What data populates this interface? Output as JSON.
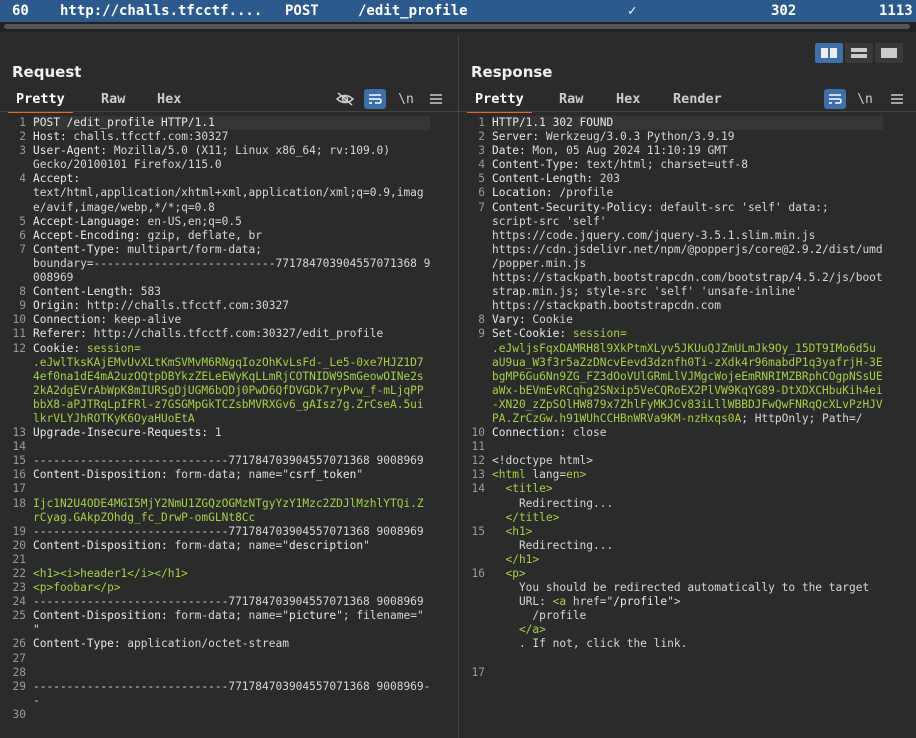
{
  "top_row": {
    "number": "60",
    "host": "http://challs.tfcctf....",
    "method": "POST",
    "path": "/edit_profile",
    "check": "✓",
    "status": "302",
    "length": "1113"
  },
  "request": {
    "title": "Request",
    "tabs": [
      "Pretty",
      "Raw",
      "Hex"
    ],
    "lines": [
      {
        "n": "1",
        "segs": [
          {
            "t": "POST /edit_profile HTTP/1.1",
            "c": "k"
          }
        ]
      },
      {
        "n": "2",
        "segs": [
          {
            "t": "Host: ",
            "c": "k"
          },
          {
            "t": "challs.tfcctf.com:30327",
            "c": "v"
          }
        ]
      },
      {
        "n": "3",
        "segs": [
          {
            "t": "User-Agent: ",
            "c": "k"
          },
          {
            "t": "Mozilla/5.0 (X11; Linux x86_64; rv:109.0)",
            "c": "v"
          }
        ]
      },
      {
        "n": "",
        "segs": [
          {
            "t": "Gecko/20100101 Firefox/115.0",
            "c": "v"
          }
        ]
      },
      {
        "n": "4",
        "segs": [
          {
            "t": "Accept:",
            "c": "k"
          }
        ]
      },
      {
        "n": "",
        "segs": [
          {
            "t": "text/html,application/xhtml+xml,application/xml;q=0.9,imag",
            "c": "v"
          }
        ]
      },
      {
        "n": "",
        "segs": [
          {
            "t": "e/avif,image/webp,*/*;q=0.8",
            "c": "v"
          }
        ]
      },
      {
        "n": "5",
        "segs": [
          {
            "t": "Accept-Language: ",
            "c": "k"
          },
          {
            "t": "en-US,en;q=0.5",
            "c": "v"
          }
        ]
      },
      {
        "n": "6",
        "segs": [
          {
            "t": "Accept-Encoding: ",
            "c": "k"
          },
          {
            "t": "gzip, deflate, br",
            "c": "v"
          }
        ]
      },
      {
        "n": "7",
        "segs": [
          {
            "t": "Content-Type: ",
            "c": "k"
          },
          {
            "t": "multipart/form-data;",
            "c": "v"
          }
        ]
      },
      {
        "n": "",
        "segs": [
          {
            "t": "boundary=---------------------------771784703904557071368 9",
            "c": "v"
          }
        ]
      },
      {
        "n": "",
        "segs": [
          {
            "t": "008969",
            "c": "v"
          }
        ]
      },
      {
        "n": "8",
        "segs": [
          {
            "t": "Content-Length: ",
            "c": "k"
          },
          {
            "t": "583",
            "c": "v"
          }
        ]
      },
      {
        "n": "9",
        "segs": [
          {
            "t": "Origin: ",
            "c": "k"
          },
          {
            "t": "http://challs.tfcctf.com:30327",
            "c": "v"
          }
        ]
      },
      {
        "n": "10",
        "segs": [
          {
            "t": "Connection: ",
            "c": "k"
          },
          {
            "t": "keep-alive",
            "c": "v"
          }
        ]
      },
      {
        "n": "11",
        "segs": [
          {
            "t": "Referer: ",
            "c": "k"
          },
          {
            "t": "http://challs.tfcctf.com:30327/edit_profile",
            "c": "v"
          }
        ]
      },
      {
        "n": "12",
        "segs": [
          {
            "t": "Cookie: ",
            "c": "k"
          },
          {
            "t": "session=",
            "c": "g"
          }
        ]
      },
      {
        "n": "",
        "segs": [
          {
            "t": ".eJwlTksKAjEMvUvXLtKmSVMvM6RNgqIozOhKvLsFd-_Le5-0xe7HJZ1D7",
            "c": "g"
          }
        ]
      },
      {
        "n": "",
        "segs": [
          {
            "t": "4ef0na1dE4mA2uzOQtpDBYkzZELeEWyKqLLmRjCOTNIDW9SmGeowOINe2s",
            "c": "g"
          }
        ]
      },
      {
        "n": "",
        "segs": [
          {
            "t": "2kA2dgEVrAbWpK8mIURSgDjUGM6bQDj0PwD6QfDVGDk7ryPvw_f-mLjqPP",
            "c": "g"
          }
        ]
      },
      {
        "n": "",
        "segs": [
          {
            "t": "bbX8-aPJTRqLpIFRl-z7GSGMpGkTCZsbMVRXGv6_gAIsz7g.ZrCseA.5ui",
            "c": "g"
          }
        ]
      },
      {
        "n": "",
        "segs": [
          {
            "t": "lkrVLYJhROTKyK6OyaHUoEtA",
            "c": "g"
          }
        ]
      },
      {
        "n": "13",
        "segs": [
          {
            "t": "Upgrade-Insecure-Requests: ",
            "c": "k"
          },
          {
            "t": "1",
            "c": "v"
          }
        ]
      },
      {
        "n": "14",
        "segs": [
          {
            "t": "",
            "c": "v"
          }
        ]
      },
      {
        "n": "15",
        "segs": [
          {
            "t": "-----------------------------771784703904557071368 9008969",
            "c": "v"
          }
        ]
      },
      {
        "n": "16",
        "segs": [
          {
            "t": "Content-Disposition: ",
            "c": "k"
          },
          {
            "t": "form-data; name=\"",
            "c": "v"
          },
          {
            "t": "csrf_token",
            "c": "k"
          },
          {
            "t": "\"",
            "c": "v"
          }
        ]
      },
      {
        "n": "17",
        "segs": [
          {
            "t": "",
            "c": "v"
          }
        ]
      },
      {
        "n": "18",
        "segs": [
          {
            "t": "Ijc1N2U4ODE4MGI5MjY2NmU1ZGQzOGMzNTgyYzY1Mzc2ZDJlMzhlYTQi.Z",
            "c": "g"
          }
        ]
      },
      {
        "n": "",
        "segs": [
          {
            "t": "rCyag.GAkpZOhdg_fc_DrwP-omGLNt8Cc",
            "c": "g"
          }
        ]
      },
      {
        "n": "19",
        "segs": [
          {
            "t": "-----------------------------771784703904557071368 9008969",
            "c": "v"
          }
        ]
      },
      {
        "n": "20",
        "segs": [
          {
            "t": "Content-Disposition: ",
            "c": "k"
          },
          {
            "t": "form-data; name=\"",
            "c": "v"
          },
          {
            "t": "description",
            "c": "k"
          },
          {
            "t": "\"",
            "c": "v"
          }
        ]
      },
      {
        "n": "21",
        "segs": [
          {
            "t": "",
            "c": "v"
          }
        ]
      },
      {
        "n": "22",
        "segs": [
          {
            "t": "<h1><i>header1</i></h1>",
            "c": "g"
          }
        ]
      },
      {
        "n": "23",
        "segs": [
          {
            "t": "<p>foobar</p>",
            "c": "g"
          }
        ]
      },
      {
        "n": "24",
        "segs": [
          {
            "t": "-----------------------------771784703904557071368 9008969",
            "c": "v"
          }
        ]
      },
      {
        "n": "25",
        "segs": [
          {
            "t": "Content-Disposition: ",
            "c": "k"
          },
          {
            "t": "form-data; name=\"",
            "c": "v"
          },
          {
            "t": "picture",
            "c": "k"
          },
          {
            "t": "\"; filename=\"",
            "c": "v"
          }
        ]
      },
      {
        "n": "",
        "segs": [
          {
            "t": "\"",
            "c": "v"
          }
        ]
      },
      {
        "n": "26",
        "segs": [
          {
            "t": "Content-Type: ",
            "c": "k"
          },
          {
            "t": "application/octet-stream",
            "c": "v"
          }
        ]
      },
      {
        "n": "27",
        "segs": [
          {
            "t": "",
            "c": "v"
          }
        ]
      },
      {
        "n": "28",
        "segs": [
          {
            "t": "",
            "c": "v"
          }
        ]
      },
      {
        "n": "29",
        "segs": [
          {
            "t": "-----------------------------771784703904557071368 9008969-",
            "c": "v"
          }
        ]
      },
      {
        "n": "",
        "segs": [
          {
            "t": "-",
            "c": "v"
          }
        ]
      },
      {
        "n": "30",
        "segs": [
          {
            "t": "",
            "c": "v"
          }
        ]
      }
    ]
  },
  "response": {
    "title": "Response",
    "tabs": [
      "Pretty",
      "Raw",
      "Hex",
      "Render"
    ],
    "lines": [
      {
        "n": "1",
        "segs": [
          {
            "t": "HTTP/1.1 302 FOUND",
            "c": "k"
          }
        ]
      },
      {
        "n": "2",
        "segs": [
          {
            "t": "Server: ",
            "c": "k"
          },
          {
            "t": "Werkzeug/3.0.3 Python/3.9.19",
            "c": "v"
          }
        ]
      },
      {
        "n": "3",
        "segs": [
          {
            "t": "Date: ",
            "c": "k"
          },
          {
            "t": "Mon, 05 Aug 2024 11:10:19 GMT",
            "c": "v"
          }
        ]
      },
      {
        "n": "4",
        "segs": [
          {
            "t": "Content-Type: ",
            "c": "k"
          },
          {
            "t": "text/html; charset=utf-8",
            "c": "v"
          }
        ]
      },
      {
        "n": "5",
        "segs": [
          {
            "t": "Content-Length: ",
            "c": "k"
          },
          {
            "t": "203",
            "c": "v"
          }
        ]
      },
      {
        "n": "6",
        "segs": [
          {
            "t": "Location: ",
            "c": "k"
          },
          {
            "t": "/profile",
            "c": "v"
          }
        ]
      },
      {
        "n": "7",
        "segs": [
          {
            "t": "Content-Security-Policy: ",
            "c": "k"
          },
          {
            "t": "default-src 'self' data:;",
            "c": "v"
          }
        ]
      },
      {
        "n": "",
        "segs": [
          {
            "t": "script-src 'self'",
            "c": "v"
          }
        ]
      },
      {
        "n": "",
        "segs": [
          {
            "t": "https://code.jquery.com/jquery-3.5.1.slim.min.js",
            "c": "v"
          }
        ]
      },
      {
        "n": "",
        "segs": [
          {
            "t": "https://cdn.jsdelivr.net/npm/@popperjs/core@2.9.2/dist/umd",
            "c": "v"
          }
        ]
      },
      {
        "n": "",
        "segs": [
          {
            "t": "/popper.min.js",
            "c": "v"
          }
        ]
      },
      {
        "n": "",
        "segs": [
          {
            "t": "https://stackpath.bootstrapcdn.com/bootstrap/4.5.2/js/boot",
            "c": "v"
          }
        ]
      },
      {
        "n": "",
        "segs": [
          {
            "t": "strap.min.js; style-src 'self' 'unsafe-inline'",
            "c": "v"
          }
        ]
      },
      {
        "n": "",
        "segs": [
          {
            "t": "https://stackpath.bootstrapcdn.com",
            "c": "v"
          }
        ]
      },
      {
        "n": "8",
        "segs": [
          {
            "t": "Vary: ",
            "c": "k"
          },
          {
            "t": "Cookie",
            "c": "v"
          }
        ]
      },
      {
        "n": "9",
        "segs": [
          {
            "t": "Set-Cookie: ",
            "c": "k"
          },
          {
            "t": "session=",
            "c": "g"
          }
        ]
      },
      {
        "n": "",
        "segs": [
          {
            "t": ".eJwljsFqxDAMRH8l9XkPtmXLyv5JKUuQJZmULmJk9Oy_15DT9IMo6d5u",
            "c": "g"
          }
        ]
      },
      {
        "n": "",
        "segs": [
          {
            "t": "aU9ua_W3f3r5aZzDNcvEevd3dznfh0Ti-zXdk4r96mabdP1q3yafrjH-3E",
            "c": "g"
          }
        ]
      },
      {
        "n": "",
        "segs": [
          {
            "t": "bgMP6Gu6Nn9ZG_FZ3dOoVUlGRmLlVJMgcWojeEmRNRIMZBRphCOgpNSsUE",
            "c": "g"
          }
        ]
      },
      {
        "n": "",
        "segs": [
          {
            "t": "aWx-bEVmEvRCqhg2SNxip5VeCQRoEX2PlVW9KqYG89-DtXDXCHbuKih4ei",
            "c": "g"
          }
        ]
      },
      {
        "n": "",
        "segs": [
          {
            "t": "-XN20_zZpSOlHW879x7ZhlFyMKJCv83iLllWBBDJFwQwFNRqQcXLvPzHJV",
            "c": "g"
          }
        ]
      },
      {
        "n": "",
        "segs": [
          {
            "t": "PA.ZrCzGw.h91WUhCCHBnWRVa9KM-nzHxqs0A",
            "c": "g"
          },
          {
            "t": "; HttpOnly; Path=/",
            "c": "v"
          }
        ]
      },
      {
        "n": "10",
        "segs": [
          {
            "t": "Connection: ",
            "c": "k"
          },
          {
            "t": "close",
            "c": "v"
          }
        ]
      },
      {
        "n": "11",
        "segs": [
          {
            "t": "",
            "c": "v"
          }
        ]
      },
      {
        "n": "12",
        "segs": [
          {
            "t": "<!doctype html>",
            "c": "v"
          }
        ]
      },
      {
        "n": "13",
        "segs": [
          {
            "t": "<html ",
            "c": "g"
          },
          {
            "t": "lang=",
            "c": "v"
          },
          {
            "t": "en",
            "c": "g"
          },
          {
            "t": ">",
            "c": "g"
          }
        ]
      },
      {
        "n": "14",
        "segs": [
          {
            "t": "  <title>",
            "c": "g"
          }
        ]
      },
      {
        "n": "",
        "segs": [
          {
            "t": "    Redirecting...",
            "c": "v"
          }
        ]
      },
      {
        "n": "",
        "segs": [
          {
            "t": "  </title>",
            "c": "g"
          }
        ]
      },
      {
        "n": "15",
        "segs": [
          {
            "t": "  <h1>",
            "c": "g"
          }
        ]
      },
      {
        "n": "",
        "segs": [
          {
            "t": "    Redirecting...",
            "c": "v"
          }
        ]
      },
      {
        "n": "",
        "segs": [
          {
            "t": "  </h1>",
            "c": "g"
          }
        ]
      },
      {
        "n": "16",
        "segs": [
          {
            "t": "  <p>",
            "c": "g"
          }
        ]
      },
      {
        "n": "",
        "segs": [
          {
            "t": "    You should be redirected automatically to the target",
            "c": "v"
          }
        ]
      },
      {
        "n": "",
        "segs": [
          {
            "t": "    URL: ",
            "c": "v"
          },
          {
            "t": "<a ",
            "c": "g"
          },
          {
            "t": "href=\"",
            "c": "v"
          },
          {
            "t": "/profile",
            "c": "k"
          },
          {
            "t": "\">",
            "c": "v"
          }
        ]
      },
      {
        "n": "",
        "segs": [
          {
            "t": "      /profile",
            "c": "v"
          }
        ]
      },
      {
        "n": "",
        "segs": [
          {
            "t": "    </a>",
            "c": "g"
          }
        ]
      },
      {
        "n": "",
        "segs": [
          {
            "t": "    . If not, click the link.",
            "c": "v"
          }
        ]
      },
      {
        "n": "",
        "segs": [
          {
            "t": "",
            "c": "v"
          }
        ]
      },
      {
        "n": "17",
        "segs": [
          {
            "t": "",
            "c": "v"
          }
        ]
      }
    ]
  },
  "icons": {
    "hide": "eye-slash-icon",
    "wrap": "word-wrap-icon",
    "newline": "\\n",
    "menu": "menu-icon"
  }
}
